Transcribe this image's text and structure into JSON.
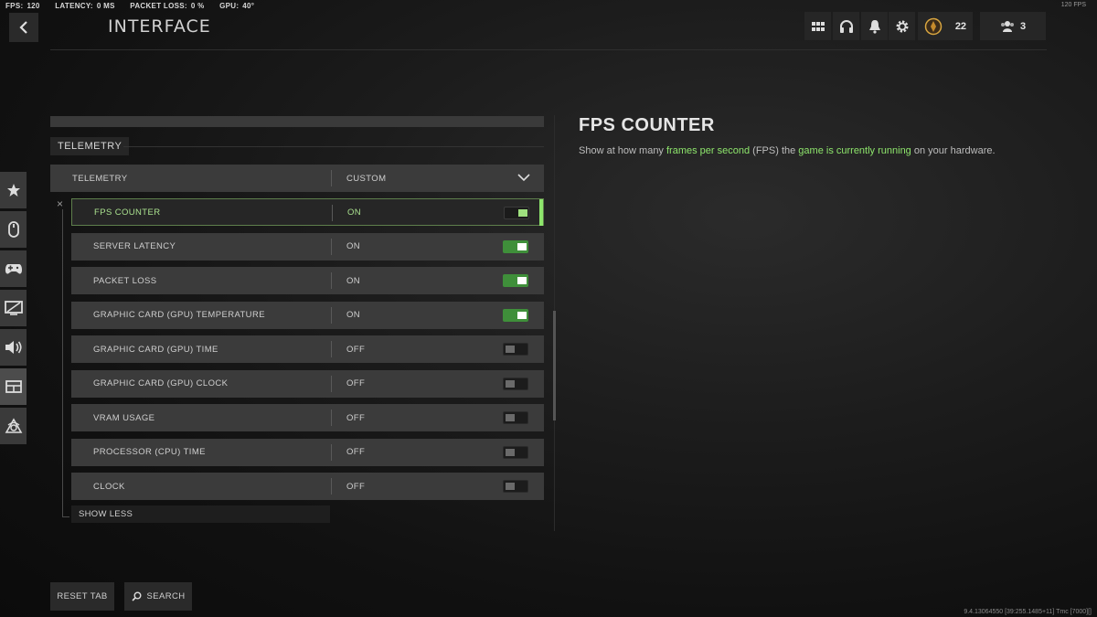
{
  "telemetry_bar": {
    "fps_label": "FPS:",
    "fps_value": "120",
    "latency_label": "LATENCY:",
    "latency_value": "0 MS",
    "packet_loss_label": "PACKET LOSS:",
    "packet_loss_value": "0 %",
    "gpu_label": "GPU:",
    "gpu_value": "40°",
    "right_fps": "120 FPS"
  },
  "header": {
    "title": "INTERFACE",
    "rank_level": "22",
    "party_count": "3",
    "icons": [
      "grid-icon",
      "headset-icon",
      "bell-icon",
      "gear-icon"
    ]
  },
  "sidebar": {
    "items": [
      {
        "icon": "star-icon"
      },
      {
        "icon": "mouse-icon"
      },
      {
        "icon": "controller-icon"
      },
      {
        "icon": "display-icon"
      },
      {
        "icon": "speaker-icon"
      },
      {
        "icon": "interface-icon",
        "active": true
      },
      {
        "icon": "network-icon"
      }
    ]
  },
  "settings": {
    "section_label": "TELEMETRY",
    "group": {
      "name": "TELEMETRY",
      "value": "CUSTOM"
    },
    "rows": [
      {
        "name": "FPS COUNTER",
        "value": "ON",
        "on": true,
        "selected": true
      },
      {
        "name": "SERVER LATENCY",
        "value": "ON",
        "on": true
      },
      {
        "name": "PACKET LOSS",
        "value": "ON",
        "on": true
      },
      {
        "name": "GRAPHIC CARD (GPU) TEMPERATURE",
        "value": "ON",
        "on": true
      },
      {
        "name": "GRAPHIC CARD (GPU) TIME",
        "value": "OFF",
        "on": false
      },
      {
        "name": "GRAPHIC CARD (GPU) CLOCK",
        "value": "OFF",
        "on": false
      },
      {
        "name": "VRAM USAGE",
        "value": "OFF",
        "on": false
      },
      {
        "name": "PROCESSOR (CPU) TIME",
        "value": "OFF",
        "on": false
      },
      {
        "name": "CLOCK",
        "value": "OFF",
        "on": false
      }
    ],
    "show_less": "SHOW LESS",
    "close_glyph": "×"
  },
  "description": {
    "title": "FPS COUNTER",
    "text_parts": [
      {
        "t": "Show at how many ",
        "hl": false
      },
      {
        "t": "frames per second",
        "hl": true
      },
      {
        "t": " (FPS) the ",
        "hl": false
      },
      {
        "t": "game is currently running",
        "hl": true
      },
      {
        "t": " on your hardware.",
        "hl": false
      }
    ]
  },
  "footer": {
    "reset_label": "RESET TAB",
    "search_label": "SEARCH",
    "build_info": "9.4.13064550 [39:255.1485+11] Tmc [7000][]"
  },
  "colors": {
    "accent": "#8ee66c",
    "toggle_on": "#3f8f3a"
  }
}
